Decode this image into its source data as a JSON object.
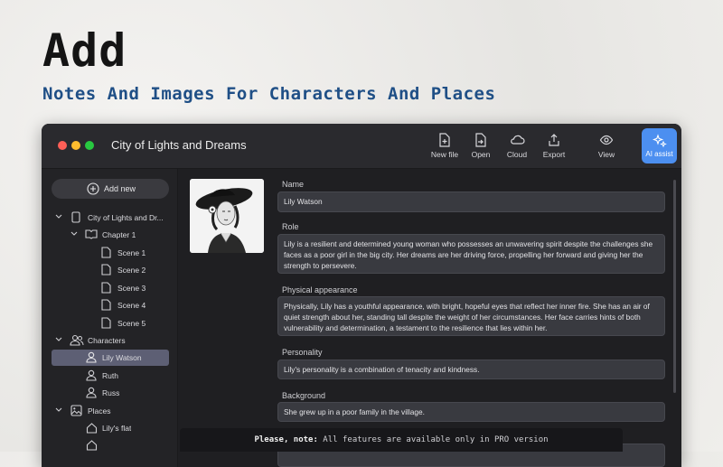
{
  "hero": {
    "title": "Add",
    "subtitle": "Notes And Images For Characters And Places"
  },
  "window": {
    "title": "City of Lights and Dreams"
  },
  "toolbar": {
    "new_file": "New file",
    "open": "Open",
    "cloud": "Cloud",
    "export": "Export",
    "view": "View",
    "ai_assist": "AI assist"
  },
  "sidebar": {
    "add_new": "Add new",
    "project": "City of Lights and Dr...",
    "chapter": "Chapter 1",
    "scenes": [
      "Scene 1",
      "Scene 2",
      "Scene 3",
      "Scene 4",
      "Scene 5"
    ],
    "characters_label": "Characters",
    "characters": [
      "Lily Watson",
      "Ruth",
      "Russ"
    ],
    "places_label": "Places",
    "places": [
      "Lily's flat",
      ""
    ]
  },
  "detail": {
    "name_label": "Name",
    "name_value": "Lily Watson",
    "role_label": "Role",
    "role_value": "Lily is a resilient and determined young woman who possesses an unwavering spirit despite the challenges she faces as a poor girl in the big city. Her dreams are her driving force, propelling her forward and giving her the strength to persevere.",
    "appearance_label": "Physical appearance",
    "appearance_value": "Physically, Lily has a youthful appearance, with bright, hopeful eyes that reflect her inner fire. She has an air of quiet strength about her, standing tall despite the weight of her circumstances. Her face carries hints of both vulnerability and determination, a testament to the resilience that lies within her.",
    "personality_label": "Personality",
    "personality_value": "Lily's personality is a combination of tenacity and kindness.",
    "background_label": "Background",
    "background_value": "She grew up in a poor family in the village."
  },
  "notice": {
    "strong": "Please, note:",
    "rest": " All features are available only in PRO version"
  },
  "colors": {
    "accent": "#4c8ff0",
    "selection": "#5d5f74",
    "subtitle": "#1f4f86"
  }
}
